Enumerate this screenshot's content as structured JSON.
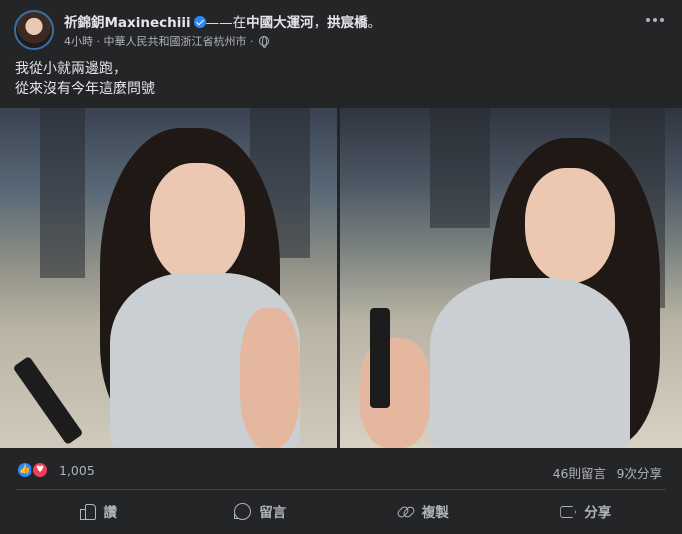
{
  "post": {
    "author_name": "祈錦鈅Maxinechiii",
    "author_prefix": "——在",
    "location": "中國大運河",
    "separator": "，",
    "activity": "拱宸橋",
    "suffix": "。",
    "time": "4小時",
    "dot": " · ",
    "place": "中華人民共和國浙江省杭州市",
    "dot2": " · ",
    "caption_lines": [
      "我從小就兩邊跑，",
      "從來沒有今年這麼問號"
    ]
  },
  "engagement": {
    "reaction_count": "1,005",
    "comment_count": "46則留言",
    "share_count": "9次分享"
  },
  "actions": {
    "like_label": "讚",
    "comment_label": "留言",
    "copy_label": "複製",
    "share_label": "分享"
  },
  "icons": {
    "verified": "verified-badge-icon",
    "privacy": "globe-icon",
    "more": "more-options-icon",
    "like_reaction": "like-reaction-icon",
    "love_reaction": "love-reaction-icon",
    "like": "thumbs-up-icon",
    "comment": "comment-icon",
    "copy": "link-icon",
    "share": "share-icon"
  },
  "colors": {
    "background": "#242526",
    "text_primary": "#e4e6eb",
    "text_secondary": "#b0b3b8",
    "verified": "#2d88ff",
    "like": "#2d88ff",
    "love": "#f33e58"
  }
}
